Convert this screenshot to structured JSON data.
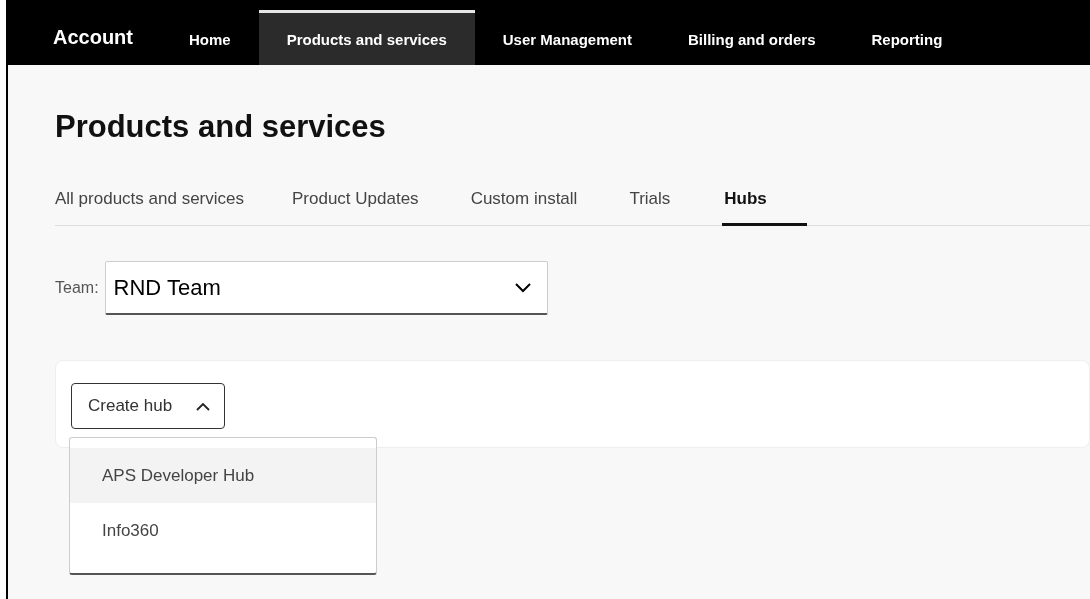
{
  "nav": {
    "brand": "Account",
    "items": [
      {
        "label": "Home",
        "selected": false
      },
      {
        "label": "Products and services",
        "selected": true
      },
      {
        "label": "User Management",
        "selected": false
      },
      {
        "label": "Billing and orders",
        "selected": false
      },
      {
        "label": "Reporting",
        "selected": false
      }
    ]
  },
  "page_title": "Products and services",
  "tabs": [
    {
      "label": "All products and services",
      "selected": false
    },
    {
      "label": "Product Updates",
      "selected": false
    },
    {
      "label": "Custom install",
      "selected": false
    },
    {
      "label": "Trials",
      "selected": false
    },
    {
      "label": "Hubs",
      "selected": true
    }
  ],
  "team": {
    "label": "Team:",
    "value": "RND Team"
  },
  "create_hub": {
    "label": "Create hub",
    "expanded": true,
    "options": [
      {
        "label": "APS Developer Hub",
        "highlighted": true
      },
      {
        "label": "Info360",
        "highlighted": false
      }
    ]
  }
}
